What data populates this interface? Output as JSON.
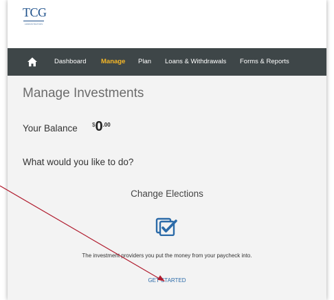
{
  "logo": {
    "text": "TCG",
    "subtext": "ADMINISTRATORS"
  },
  "nav": {
    "home_icon": "home-icon",
    "items": [
      {
        "label": "Dashboard",
        "active": false
      },
      {
        "label": "Manage",
        "active": true
      },
      {
        "label": "Plan",
        "active": false
      },
      {
        "label": "Loans & Withdrawals",
        "active": false
      },
      {
        "label": "Forms & Reports",
        "active": false
      }
    ]
  },
  "main": {
    "title": "Manage Investments",
    "balance_label": "Your Balance",
    "balance_currency": "$",
    "balance_whole": "0",
    "balance_cents": ".00",
    "question": "What would you like to do?",
    "option": {
      "title": "Change Elections",
      "icon": "checkbox-edit-icon",
      "description": "The investment providers you put the money from your paycheck into.",
      "cta_label": "GET STARTED"
    }
  },
  "annotation": {
    "arrow_icon": "annotation-arrow",
    "color": "#b01c2e"
  },
  "colors": {
    "navbar": "#3e4648",
    "active_nav": "#f6b726",
    "accent": "#2b6aa8",
    "brand": "#1c4f8a"
  }
}
